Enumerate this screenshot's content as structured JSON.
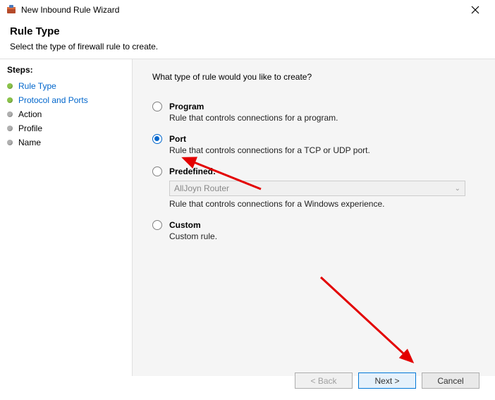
{
  "window": {
    "title": "New Inbound Rule Wizard"
  },
  "header": {
    "title": "Rule Type",
    "description": "Select the type of firewall rule to create."
  },
  "sidebar": {
    "title": "Steps:",
    "items": [
      {
        "label": "Rule Type"
      },
      {
        "label": "Protocol and Ports"
      },
      {
        "label": "Action"
      },
      {
        "label": "Profile"
      },
      {
        "label": "Name"
      }
    ]
  },
  "content": {
    "question": "What type of rule would you like to create?",
    "options": {
      "program": {
        "label": "Program",
        "desc": "Rule that controls connections for a program."
      },
      "port": {
        "label": "Port",
        "desc": "Rule that controls connections for a TCP or UDP port."
      },
      "predefined": {
        "label": "Predefined:",
        "select_value": "AllJoyn Router",
        "desc": "Rule that controls connections for a Windows experience."
      },
      "custom": {
        "label": "Custom",
        "desc": "Custom rule."
      }
    },
    "selected": "port"
  },
  "buttons": {
    "back": "< Back",
    "next": "Next >",
    "cancel": "Cancel"
  }
}
